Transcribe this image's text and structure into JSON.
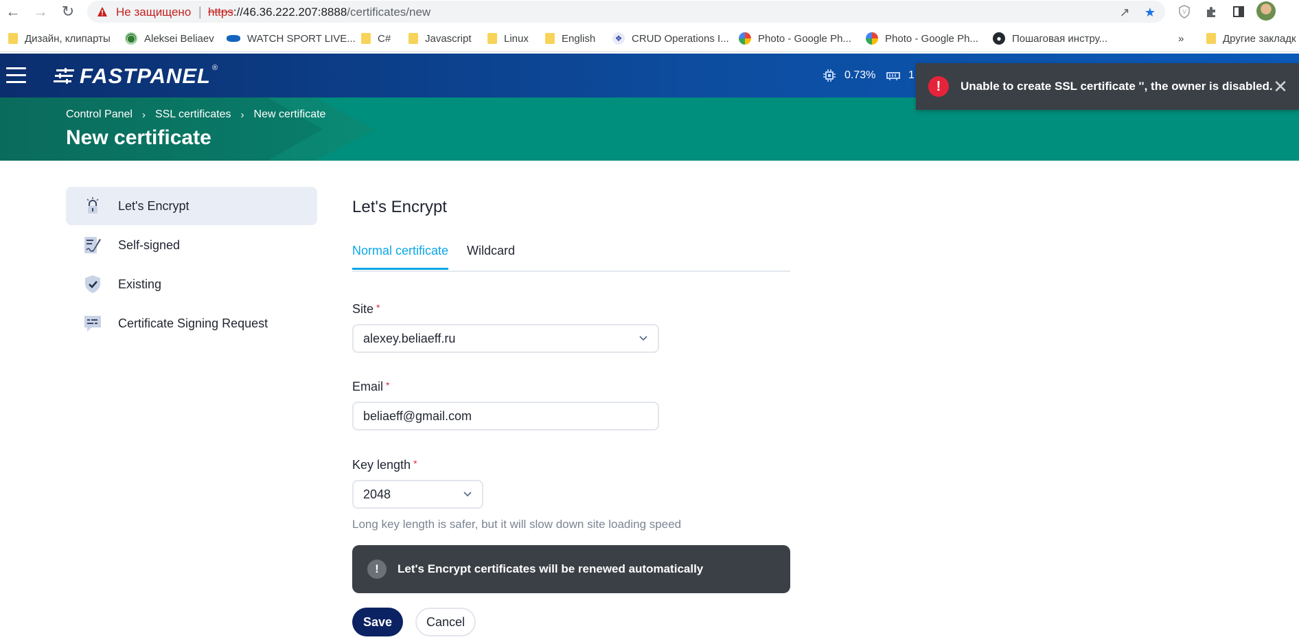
{
  "browser": {
    "security_label": "Не защищено",
    "url_scheme": "https",
    "url_host": "://46.36.222.207:8888",
    "url_path": "/certificates/new",
    "bookmarks": [
      {
        "label": "Дизайн, клипарты",
        "icon": "folder-icon"
      },
      {
        "label": "Aleksei Beliaev",
        "icon": "green-circle-icon"
      },
      {
        "label": "WATCH SPORT LIVE...",
        "icon": "sport-icon"
      },
      {
        "label": "C#",
        "icon": "folder-icon"
      },
      {
        "label": "Javascript",
        "icon": "folder-icon"
      },
      {
        "label": "Linux",
        "icon": "folder-icon"
      },
      {
        "label": "English",
        "icon": "folder-icon"
      },
      {
        "label": "CRUD Operations I...",
        "icon": "crud-icon"
      },
      {
        "label": "Photo - Google Ph...",
        "icon": "google-photos-icon"
      },
      {
        "label": "Photo - Google Ph...",
        "icon": "google-photos-icon"
      },
      {
        "label": "Пошаговая инстру...",
        "icon": "github-icon"
      }
    ],
    "overflow_label": "»",
    "other_bookmarks": "Другие закладк"
  },
  "header": {
    "logo_text": "FASTPANEL",
    "logo_reg": "®",
    "cpu_value": "0.73%",
    "ram_value_partial": "1"
  },
  "band": {
    "breadcrumb": [
      "Control Panel",
      "SSL certificates",
      "New certificate"
    ],
    "breadcrumb_sep": "›",
    "title": "New certificate"
  },
  "toast": {
    "icon": "!",
    "message": "Unable to create SSL certificate '', the owner is disabled.",
    "close": "✕"
  },
  "sidebar": {
    "items": [
      {
        "label": "Let's Encrypt",
        "icon": "lock-bulb-icon",
        "active": true
      },
      {
        "label": "Self-signed",
        "icon": "signed-document-icon",
        "active": false
      },
      {
        "label": "Existing",
        "icon": "shield-check-icon",
        "active": false
      },
      {
        "label": "Certificate Signing Request",
        "icon": "csr-message-icon",
        "active": false
      }
    ]
  },
  "form": {
    "section_title": "Let's Encrypt",
    "tabs": [
      {
        "label": "Normal certificate",
        "active": true
      },
      {
        "label": "Wildcard",
        "active": false
      }
    ],
    "site_label": "Site",
    "site_value": "alexey.beliaeff.ru",
    "email_label": "Email",
    "email_value": "beliaeff@gmail.com",
    "key_label": "Key length",
    "key_value": "2048",
    "required_mark": "*",
    "key_hint": "Long key length is safer, but it will slow down site loading speed",
    "notice_icon": "!",
    "notice_text": "Let's Encrypt certificates will be renewed automatically",
    "save_label": "Save",
    "cancel_label": "Cancel"
  },
  "colors": {
    "header_blue": "#0d4da0",
    "band_green": "#008f7c",
    "accent": "#0aa7e6",
    "error": "#e5243b",
    "save_button": "#0b2263"
  }
}
